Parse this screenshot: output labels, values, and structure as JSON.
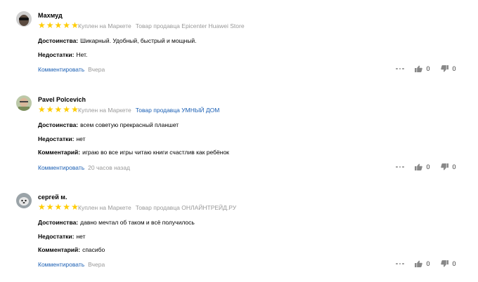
{
  "reviews": [
    {
      "author": "Махмуд",
      "stars": "★★★★★",
      "bought": "Куплен на Маркете",
      "seller": "Товар продавца Epicenter Huawei Store",
      "seller_is_link": false,
      "advantages_label": "Достоинства:",
      "advantages": "Шикарный. Удобный, быстрый и мощный.",
      "disadvantages_label": "Недостатки:",
      "disadvantages": "Нет.",
      "comment_label": "",
      "comment": "",
      "reply_link": "Комментировать",
      "date": "Вчера",
      "likes": "0",
      "dislikes": "0"
    },
    {
      "author": "Pavel Polcevich",
      "stars": "★★★★★",
      "bought": "Куплен на Маркете",
      "seller": "Товар продавца УМНЫЙ ДОМ",
      "seller_is_link": true,
      "advantages_label": "Достоинства:",
      "advantages": "всем советую прекрасный планшет",
      "disadvantages_label": "Недостатки:",
      "disadvantages": "нет",
      "comment_label": "Комментарий:",
      "comment": "играю во все игры читаю книги счастлив как ребёнок",
      "reply_link": "Комментировать",
      "date": "20 часов назад",
      "likes": "0",
      "dislikes": "0"
    },
    {
      "author": "сергей м.",
      "stars": "★★★★★",
      "bought": "Куплен на Маркете",
      "seller": "Товар продавца ОНЛАЙНТРЕЙД.РУ",
      "seller_is_link": false,
      "advantages_label": "Достоинства:",
      "advantages": "давно мечтал об таком и всё получилось",
      "disadvantages_label": "Недостатки:",
      "disadvantages": "нет",
      "comment_label": "Комментарий:",
      "comment": "спасибо",
      "reply_link": "Комментировать",
      "date": "Вчера",
      "likes": "0",
      "dislikes": "0"
    }
  ],
  "colors": {
    "star": "#ffcc00",
    "link": "#1a5fb4",
    "muted": "#999999"
  },
  "icons": {
    "more": "more-dots-icon",
    "like": "thumbs-up-icon",
    "dislike": "thumbs-down-icon"
  }
}
